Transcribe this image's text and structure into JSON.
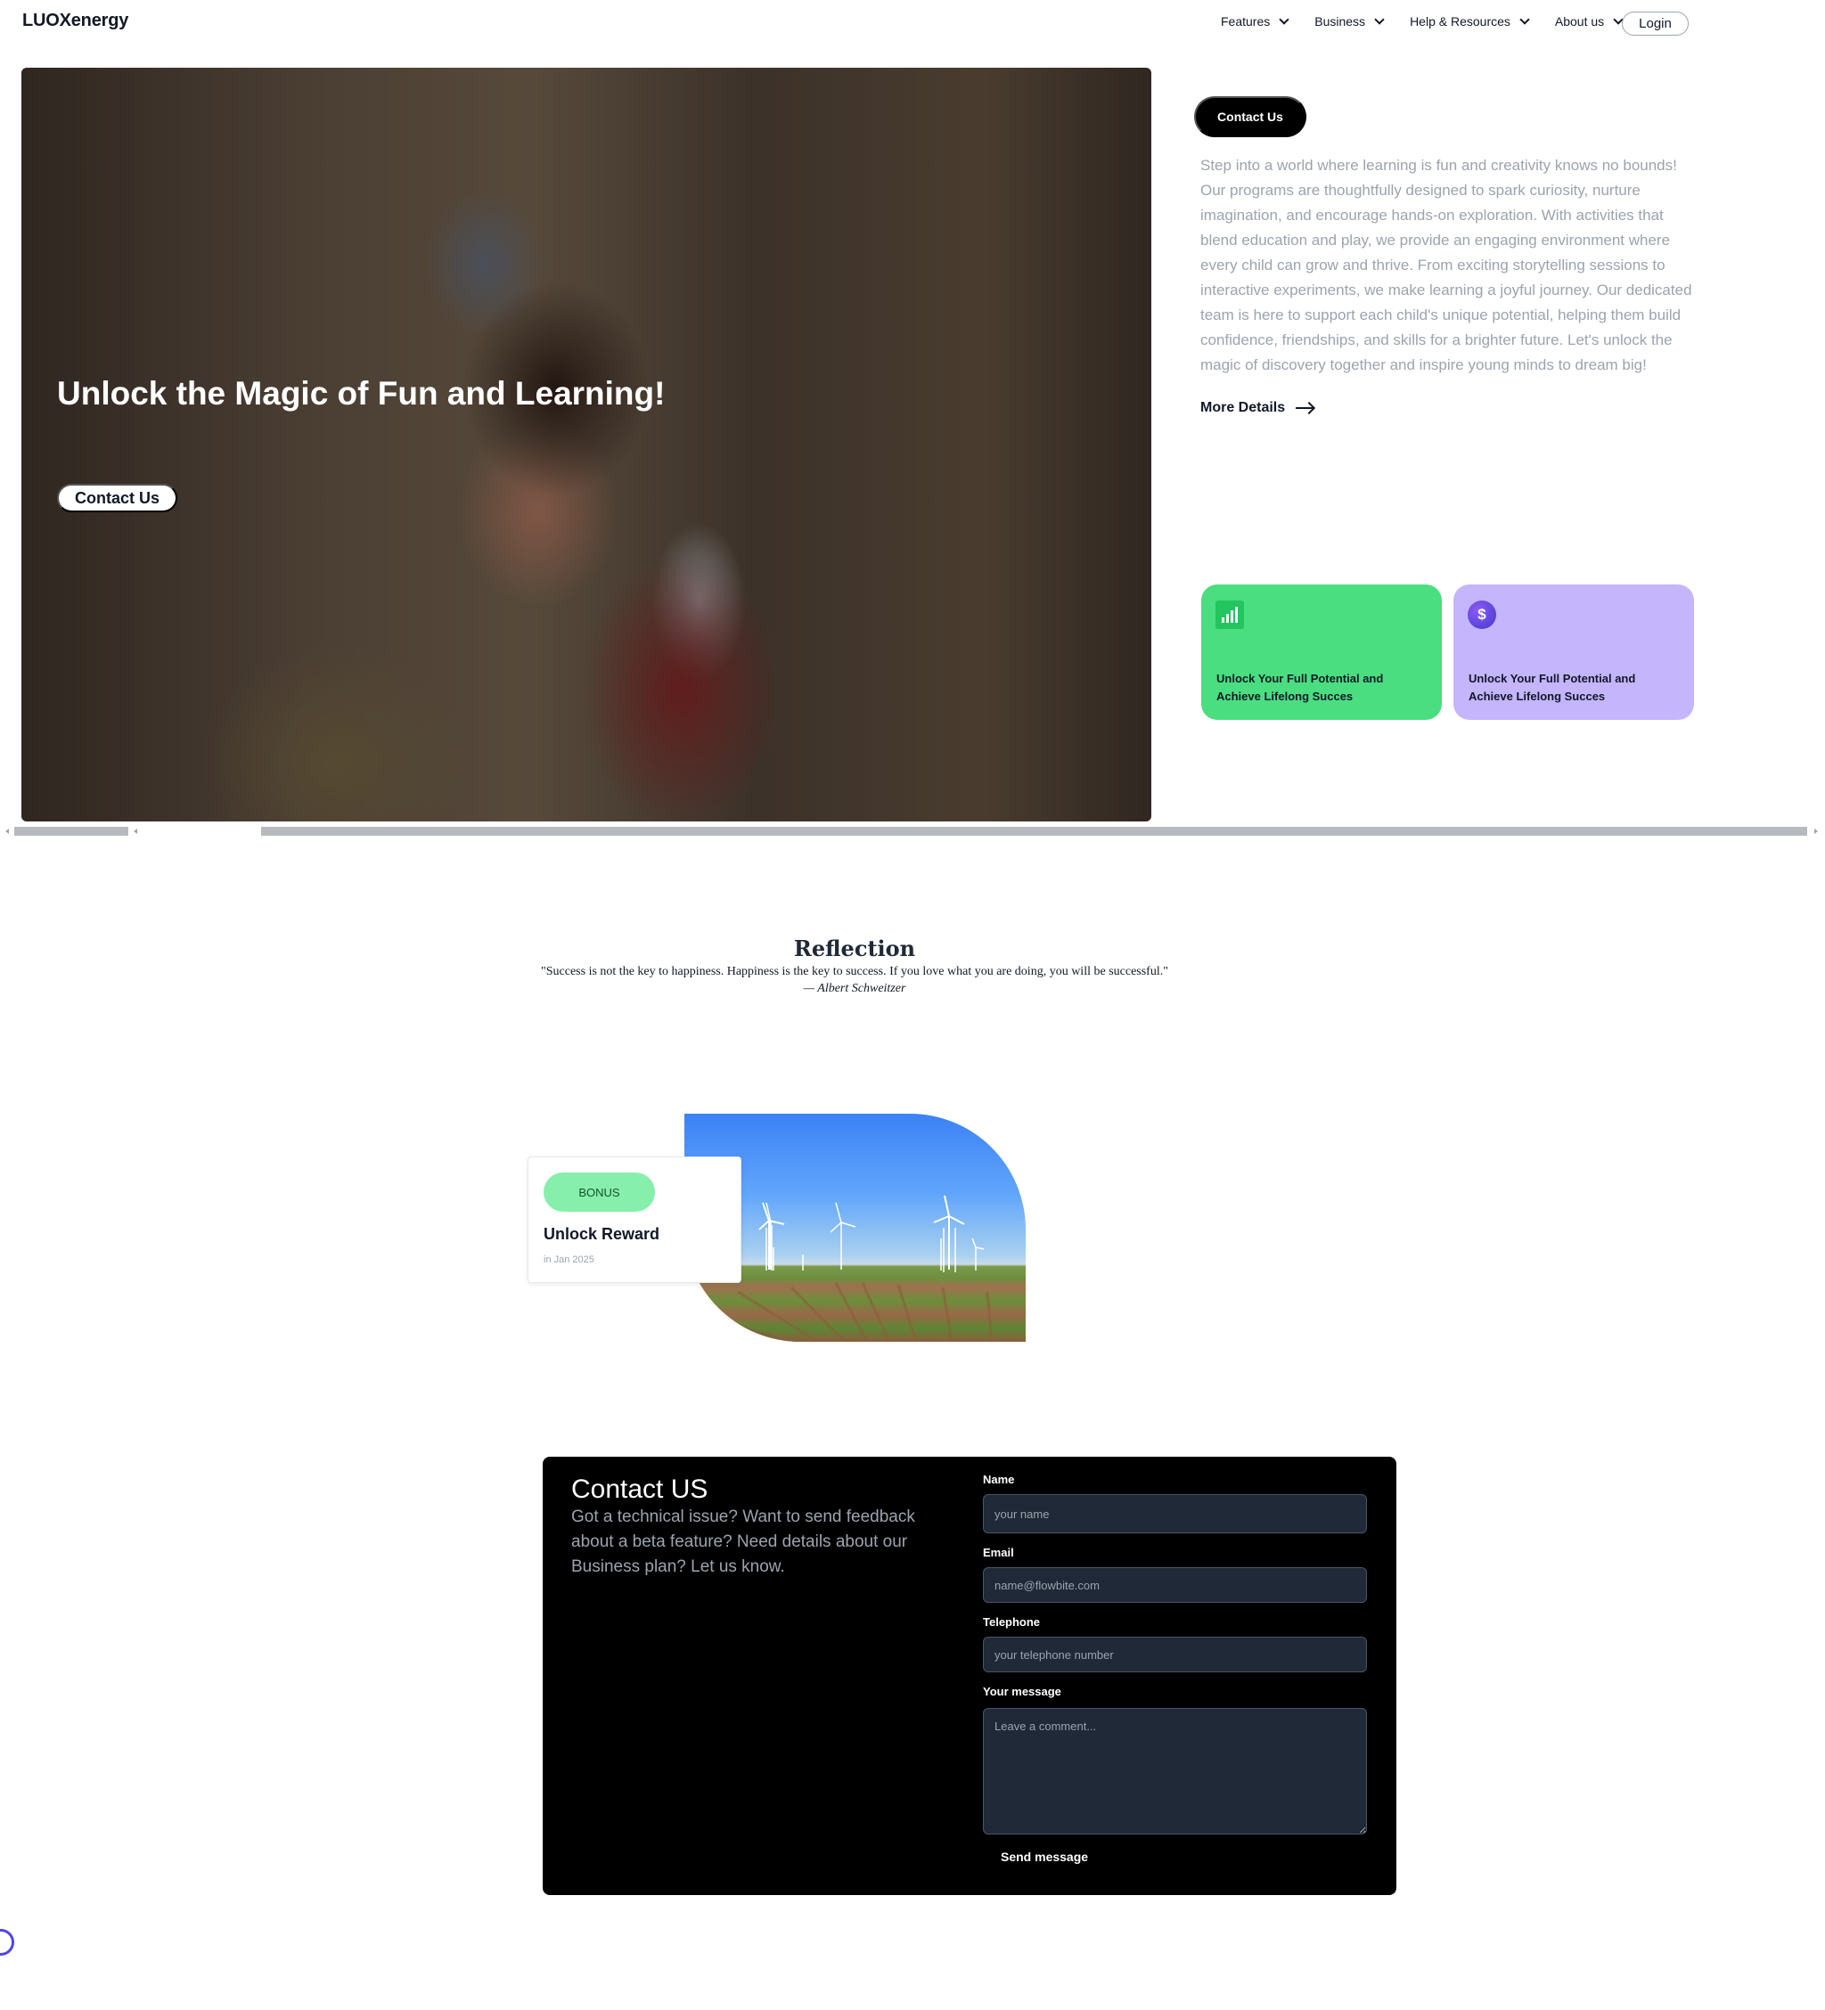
{
  "nav": {
    "logo": "LUOXenergy",
    "items": [
      {
        "label": "Features"
      },
      {
        "label": "Business"
      },
      {
        "label": "Help & Resources"
      },
      {
        "label": "About us"
      }
    ],
    "login": "Login"
  },
  "hero": {
    "title": "Unlock the Magic of Fun and Learning!",
    "button": "Contact Us"
  },
  "side": {
    "contact_button": "Contact Us",
    "intro": "Step into a world where learning is fun and creativity knows no bounds! Our programs are thoughtfully designed to spark curiosity, nurture imagination, and encourage hands-on exploration. With activities that blend education and play, we provide an engaging environment where every child can grow and thrive. From exciting storytelling sessions to interactive experiments, we make learning a joyful journey. Our dedicated team is here to support each child's unique potential, helping them build confidence, friendships, and skills for a brighter future. Let's unlock the magic of discovery together and inspire young minds to dream big!",
    "more_details": "More Details",
    "cards": [
      {
        "icon": "bar-chart-icon",
        "text": "Unlock Your Full Potential and Achieve Lifelong Succes",
        "color": "#4ade80"
      },
      {
        "icon": "dollar-icon",
        "text": "Unlock Your Full Potential and Achieve Lifelong Succes",
        "color": "#c4b5fd"
      }
    ]
  },
  "reflection": {
    "title": "Reflection",
    "quote": "\"Success is not the key to happiness. Happiness is the key to success. If you love what you are doing, you will be successful.\"",
    "author": "— Albert Schweitzer"
  },
  "reward": {
    "badge": "BONUS",
    "title": "Unlock Reward",
    "date": "in Jan 2025"
  },
  "contact": {
    "title": "Contact US",
    "description": "Got a technical issue? Want to send feedback about a beta feature? Need details about our Business plan? Let us know.",
    "name_label": "Name",
    "name_placeholder": "your name",
    "email_label": "Email",
    "email_placeholder": "name@flowbite.com",
    "phone_label": "Telephone",
    "phone_placeholder": "your telephone number",
    "message_label": "Your message",
    "message_placeholder": "Leave a comment...",
    "submit": "Send message"
  },
  "colors": {
    "accent_green": "#4ade80",
    "accent_purple": "#c4b5fd",
    "dark": "#000000",
    "input_bg": "#1f2937"
  }
}
